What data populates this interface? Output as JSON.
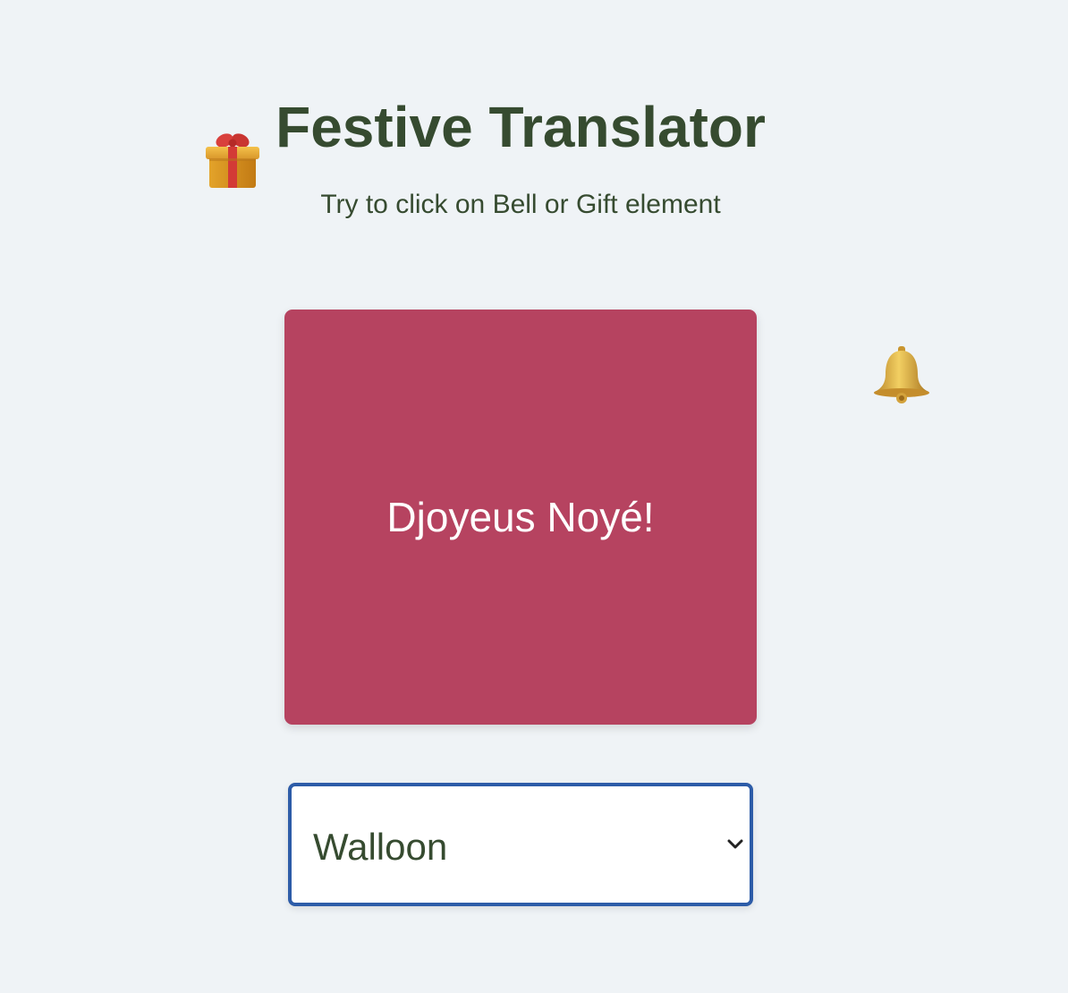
{
  "header": {
    "title": "Festive Translator",
    "subtitle": "Try to click on Bell or Gift element"
  },
  "decorations": {
    "gift_icon": "gift-icon",
    "bell_icon": "bell-icon"
  },
  "card": {
    "greeting": "Djoyeus Noyé!",
    "background_color": "#b64360"
  },
  "language_select": {
    "selected": "Walloon",
    "border_color": "#2d5ca8"
  },
  "colors": {
    "page_background": "#eff3f6",
    "text_primary": "#364b30"
  }
}
